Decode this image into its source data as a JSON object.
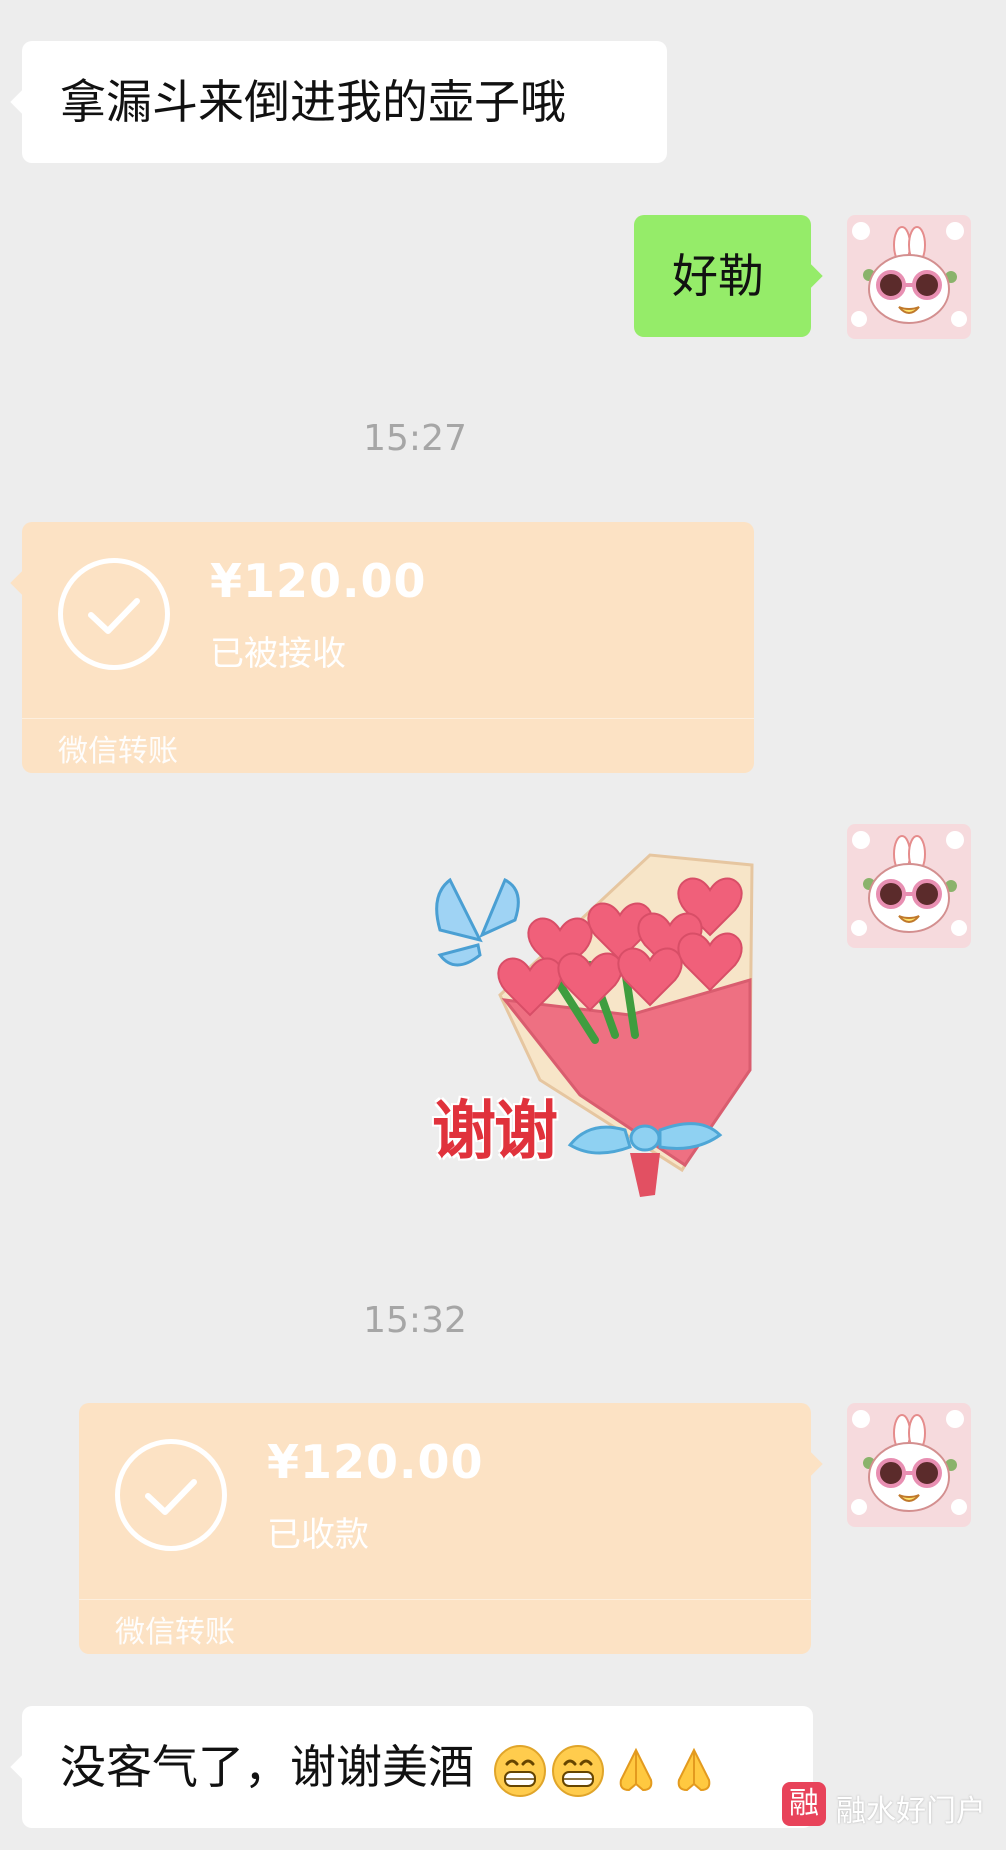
{
  "messages": {
    "m1_text": "拿漏斗来倒进我的壶子哦",
    "m2_text": "好勒",
    "m7_text": "没客气了，谢谢美酒"
  },
  "timestamps": {
    "t1": "15:27",
    "t2": "15:32"
  },
  "transfer1": {
    "amount": "¥120.00",
    "status": "已被接收",
    "footer": "微信转账"
  },
  "transfer2": {
    "amount": "¥120.00",
    "status": "已收款",
    "footer": "微信转账"
  },
  "sticker": {
    "text": "谢谢"
  },
  "emojis": [
    "grin-emoji",
    "grin-emoji",
    "pray-emoji",
    "pray-emoji"
  ],
  "watermark": {
    "logo_char": "融",
    "name": "融水好门户"
  },
  "colors": {
    "background": "#ededed",
    "bubble_white": "#ffffff",
    "bubble_green": "#95ec69",
    "transfer_card": "#fce2c4",
    "timestamp_text": "#a6a6a6"
  }
}
